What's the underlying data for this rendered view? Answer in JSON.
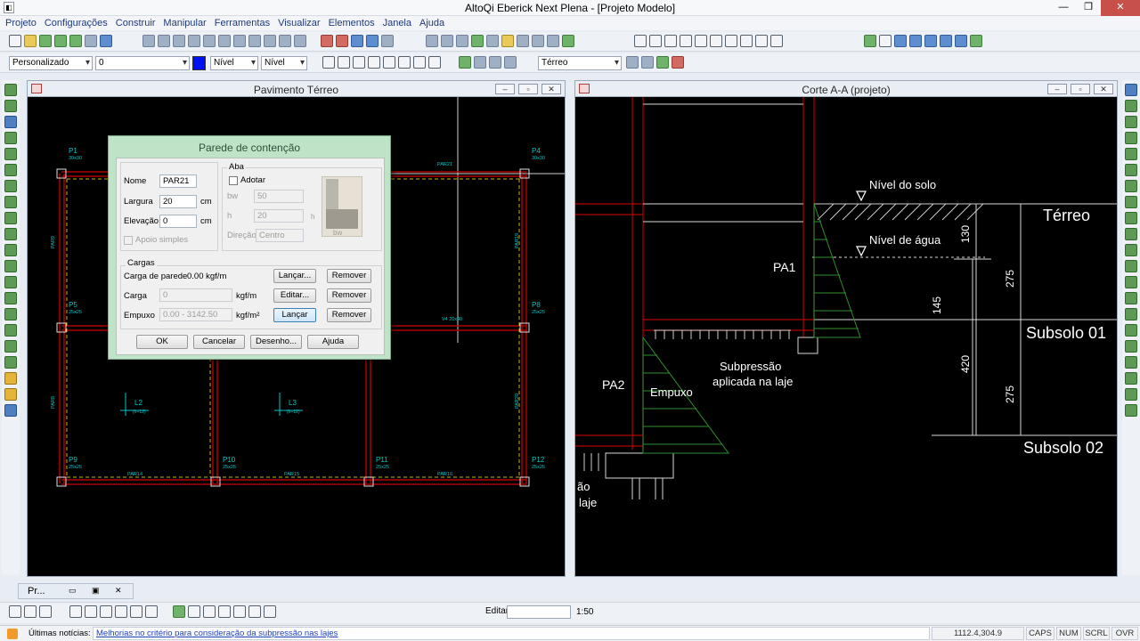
{
  "window": {
    "title": "AltoQi Eberick Next Plena - [Projeto Modelo]"
  },
  "menu": [
    "Projeto",
    "Configurações",
    "Construir",
    "Manipular",
    "Ferramentas",
    "Visualizar",
    "Elementos",
    "Janela",
    "Ajuda"
  ],
  "toolbar2": {
    "style_combo": "Personalizado",
    "layer_combo": "0",
    "level_combo_1": "Nível",
    "level_combo_2": "Nível",
    "floor_combo": "Térreo",
    "color": "#0010f0"
  },
  "plan_window": {
    "title": "Pavimento Térreo",
    "grid_color": "#00c8c8",
    "beam_color": "#b00000",
    "pillars": [
      {
        "name": "P1",
        "size": "30x30"
      },
      {
        "name": "P4",
        "size": "30x30"
      },
      {
        "name": "P5",
        "size": "25x25"
      },
      {
        "name": "P8",
        "size": "25x25"
      },
      {
        "name": "P9",
        "size": "25x25"
      },
      {
        "name": "P10",
        "size": "25x25"
      },
      {
        "name": "P11",
        "size": "25x25"
      },
      {
        "name": "P12",
        "size": "25x25"
      }
    ],
    "walls": [
      "PAR21",
      "PAR14",
      "PAR15",
      "PAR16",
      "PAR19",
      "PAR9",
      "PAR8",
      "PAR20"
    ],
    "beam_label": "V4 20x40",
    "slabs": [
      {
        "name": "L2",
        "thickness": "(h=12)"
      },
      {
        "name": "L3",
        "thickness": "(h=12)"
      }
    ]
  },
  "section_window": {
    "title": "Corte A-A (projeto)",
    "labels": {
      "ground_level": "Nível do solo",
      "water_level": "Nível de água",
      "floor_terreo": "Térreo",
      "floor_subsolo1": "Subsolo 01",
      "floor_subsolo2": "Subsolo 02",
      "wall_pa1": "PA1",
      "wall_pa2": "PA2",
      "empuxo": "Empuxo",
      "subpressao_line1": "Subpressão",
      "subpressao_line2": "aplicada na laje",
      "cut_text_1": "ão",
      "cut_text_2": "laje"
    },
    "dimensions": [
      "130",
      "275",
      "145",
      "420",
      "275"
    ]
  },
  "dialog": {
    "title": "Parede de contenção",
    "nome_label": "Nome",
    "nome_value": "PAR21",
    "largura_label": "Largura",
    "largura_value": "20",
    "largura_unit": "cm",
    "elevacao_label": "Elevação",
    "elevacao_value": "0",
    "elevacao_unit": "cm",
    "apoio_label": "Apoio simples",
    "aba_title": "Aba",
    "adotar_label": "Adotar",
    "bw_label": "bw",
    "bw_value": "50",
    "h_label": "h",
    "h_value": "20",
    "direcao_label": "Direção",
    "direcao_value": "Centro",
    "preview_h": "h",
    "preview_bw": "bw",
    "cargas_title": "Cargas",
    "carga_parede_label": "Carga de parede",
    "carga_parede_value": "0.00 kgf/m",
    "carga_label": "Carga",
    "carga_value": "0",
    "carga_unit": "kgf/m",
    "empuxo_label": "Empuxo",
    "empuxo_value": "0.00 - 3142.50",
    "empuxo_unit": "kgf/m²",
    "lancar_1": "Lançar...",
    "remover_1": "Remover",
    "editar": "Editar...",
    "remover_2": "Remover",
    "lancar_2": "Lançar",
    "remover_3": "Remover",
    "ok": "OK",
    "cancelar": "Cancelar",
    "desenho": "Desenho...",
    "ajuda": "Ajuda"
  },
  "panel_strip": {
    "label": "Pr..."
  },
  "bottom": {
    "editar_label": "Editar",
    "editar_value": "",
    "scale": "1:50"
  },
  "statusbar": {
    "news_label": "Últimas notícias:",
    "news_link": "Melhorias no critério para consideração da subpressão nas lajes",
    "coords": "1112.4,304.9",
    "caps": "CAPS",
    "num": "NUM",
    "scrl": "SCRL",
    "ovr": "OVR"
  }
}
